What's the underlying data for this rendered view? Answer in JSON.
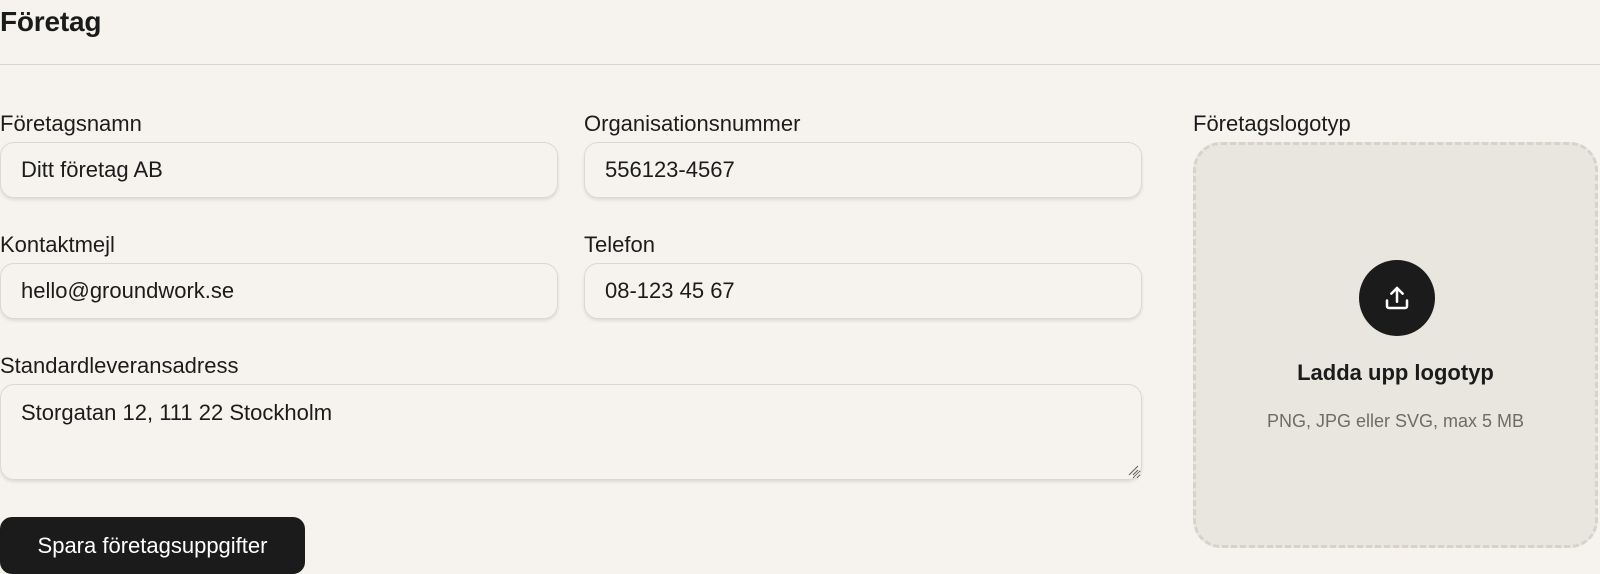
{
  "section": {
    "title": "Företag"
  },
  "form": {
    "company_name": {
      "label": "Företagsnamn",
      "value": "Ditt företag AB"
    },
    "org_number": {
      "label": "Organisationsnummer",
      "value": "556123-4567"
    },
    "contact_email": {
      "label": "Kontaktmejl",
      "value": "hello@groundwork.se"
    },
    "phone": {
      "label": "Telefon",
      "value": "08-123 45 67"
    },
    "default_address": {
      "label": "Standardleveransadress",
      "value": "Storgatan 12, 111 22 Stockholm"
    },
    "save_label": "Spara företagsuppgifter"
  },
  "logo": {
    "label": "Företagslogotyp",
    "upload_title": "Ladda upp logotyp",
    "upload_hint": "PNG, JPG eller SVG, max 5 MB",
    "icon": "upload-icon"
  },
  "colors": {
    "background": "#f6f3ee",
    "primary": "#1b1b1b",
    "dropzone": "#e9e6df",
    "muted_text": "#6f6c66"
  }
}
